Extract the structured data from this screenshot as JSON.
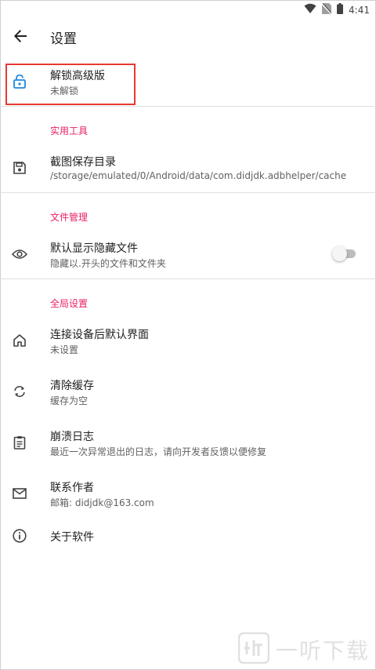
{
  "status_bar": {
    "time": "4:41",
    "icons": [
      "wifi-icon",
      "no-sim-icon",
      "battery-icon"
    ]
  },
  "app_bar": {
    "back_icon": "arrow-back-icon",
    "title": "设置"
  },
  "unlock": {
    "icon": "lock-open-icon",
    "title": "解锁高级版",
    "subtitle": "未解锁",
    "icon_color": "#1e88e5",
    "highlight_color": "#e53935"
  },
  "sections": {
    "tools": {
      "header": "实用工具"
    },
    "files": {
      "header": "文件管理"
    },
    "global": {
      "header": "全局设置"
    }
  },
  "screenshot_dir": {
    "icon": "save-icon",
    "title": "截图保存目录",
    "subtitle": "/storage/emulated/0/Android/data/com.didjdk.adbhelper/cache"
  },
  "show_hidden": {
    "icon": "eye-icon",
    "title": "默认显示隐藏文件",
    "subtitle": "隐藏以.开头的文件和文件夹",
    "toggle_on": false
  },
  "default_screen": {
    "icon": "home-icon",
    "title": "连接设备后默认界面",
    "subtitle": "未设置"
  },
  "clear_cache": {
    "icon": "refresh-icon",
    "title": "清除缓存",
    "subtitle": "缓存为空"
  },
  "crash_log": {
    "icon": "clipboard-icon",
    "title": "崩溃日志",
    "subtitle": "最近一次异常退出的日志，请向开发者反馈以便修复"
  },
  "contact": {
    "icon": "mail-icon",
    "title": "联系作者",
    "subtitle": "邮箱: didjdk@163.com"
  },
  "about": {
    "icon": "info-icon",
    "title": "关于软件"
  },
  "accent_color": "#e91e63",
  "watermark": {
    "logo_icon": "watermark-logo-icon",
    "text": "一听下载"
  }
}
